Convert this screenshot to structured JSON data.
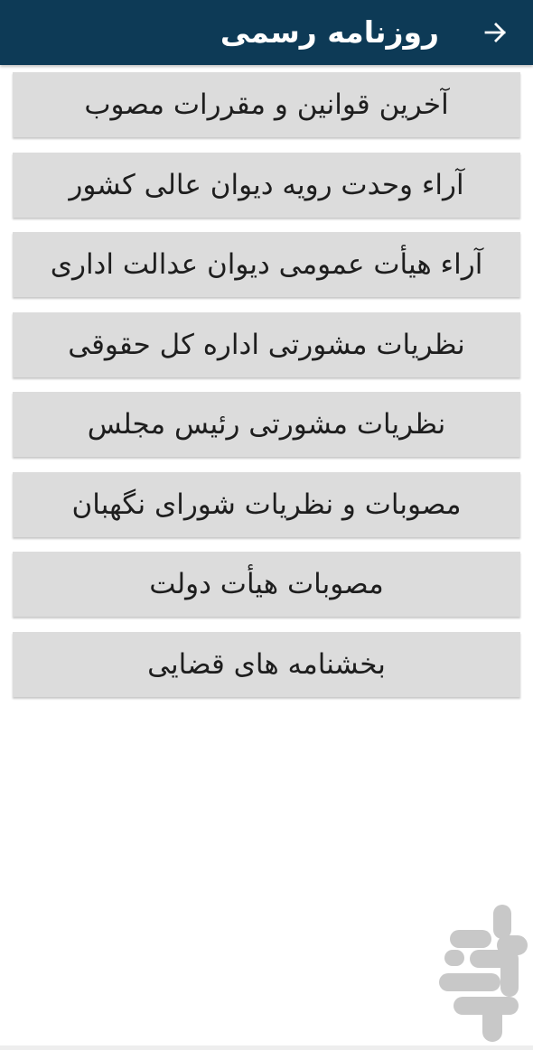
{
  "header": {
    "title": "روزنامه رسمی",
    "back_icon": "arrow-back-icon",
    "background_color": "#0d3a56"
  },
  "menu": {
    "items": [
      {
        "label": "آخرین قوانین و مقررات مصوب"
      },
      {
        "label": "آراء وحدت رویه دیوان عالی کشور"
      },
      {
        "label": "آراء هیأت عمومی دیوان عدالت اداری"
      },
      {
        "label": "نظریات مشورتی اداره کل حقوقی"
      },
      {
        "label": "نظریات مشورتی رئیس مجلس"
      },
      {
        "label": "مصوبات و نظریات شورای نگهبان"
      },
      {
        "label": "مصوبات هیأت دولت"
      },
      {
        "label": "بخشنامه های قضایی"
      }
    ],
    "item_background": "#dcdcdc"
  },
  "watermark": {
    "icon": "store-logo-icon",
    "color": "#c8c8c8"
  }
}
